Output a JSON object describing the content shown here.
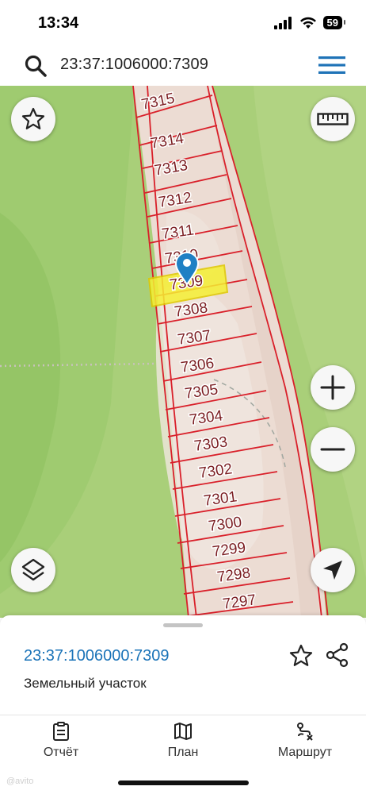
{
  "status_bar": {
    "time": "13:34",
    "battery": "59",
    "icons": [
      "signal-icon",
      "wifi-icon",
      "battery-icon"
    ]
  },
  "search": {
    "query": "23:37:1006000:7309",
    "icons": [
      "search-icon",
      "menu-icon"
    ]
  },
  "map": {
    "parcels": [
      "7315",
      "7314",
      "7313",
      "7312",
      "7311",
      "7310",
      "7309",
      "7308",
      "7307",
      "7306",
      "7305",
      "7304",
      "7303",
      "7302",
      "7301",
      "7300",
      "7299",
      "7298",
      "7297"
    ],
    "selected_parcel": "7309",
    "colors": {
      "field_green": "#a9cf79",
      "forest_green": "#93c466",
      "strip": "#ecdcd3",
      "boundary_red": "#d9202a",
      "selection_yellow": "#f5ef33",
      "pin_blue": "#1f80c4"
    },
    "buttons": [
      "favorite-star-icon",
      "ruler-icon",
      "zoom-in-icon",
      "zoom-out-icon",
      "layers-icon",
      "my-location-arrow-icon"
    ]
  },
  "sheet": {
    "cadastral_number": "23:37:1006000:7309",
    "object_type": "Земельный участок"
  },
  "nav": {
    "items": [
      {
        "label": "Отчёт",
        "icon": "report-clipboard-icon"
      },
      {
        "label": "План",
        "icon": "map-plan-icon"
      },
      {
        "label": "Маршрут",
        "icon": "route-icon"
      }
    ]
  },
  "watermark": "@avito"
}
